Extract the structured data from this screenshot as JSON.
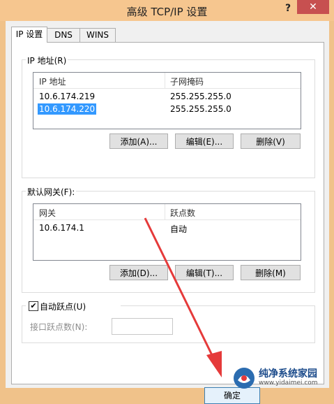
{
  "window": {
    "title": "高级 TCP/IP 设置",
    "help": "?",
    "close": "✕"
  },
  "tabs": [
    {
      "label": "IP 设置",
      "active": true
    },
    {
      "label": "DNS",
      "active": false
    },
    {
      "label": "WINS",
      "active": false
    }
  ],
  "ip_group": {
    "label": "IP 地址(R)",
    "columns": [
      "IP 地址",
      "子网掩码"
    ],
    "rows": [
      {
        "ip": "10.6.174.219",
        "mask": "255.255.255.0",
        "selected": false
      },
      {
        "ip": "10.6.174.220",
        "mask": "255.255.255.0",
        "selected": true
      }
    ],
    "buttons": {
      "add": "添加(A)...",
      "edit": "编辑(E)...",
      "delete": "删除(V)"
    }
  },
  "gateway_group": {
    "label": "默认网关(F):",
    "columns": [
      "网关",
      "跃点数"
    ],
    "rows": [
      {
        "gateway": "10.6.174.1",
        "metric": "自动"
      }
    ],
    "buttons": {
      "add": "添加(D)...",
      "edit": "编辑(T)...",
      "delete": "删除(M)"
    }
  },
  "metric": {
    "auto_label": "自动跃点(U)",
    "auto_checked": true,
    "interface_label": "接口跃点数(N):",
    "interface_value": ""
  },
  "footer": {
    "ok": "确定"
  },
  "watermark": {
    "text": "纯净系统家园",
    "url": "www.yidaimei.com"
  },
  "colors": {
    "titlebar": "#f6c68f",
    "close": "#c75050",
    "selection": "#3399ff",
    "arrow": "#e53a3a"
  }
}
